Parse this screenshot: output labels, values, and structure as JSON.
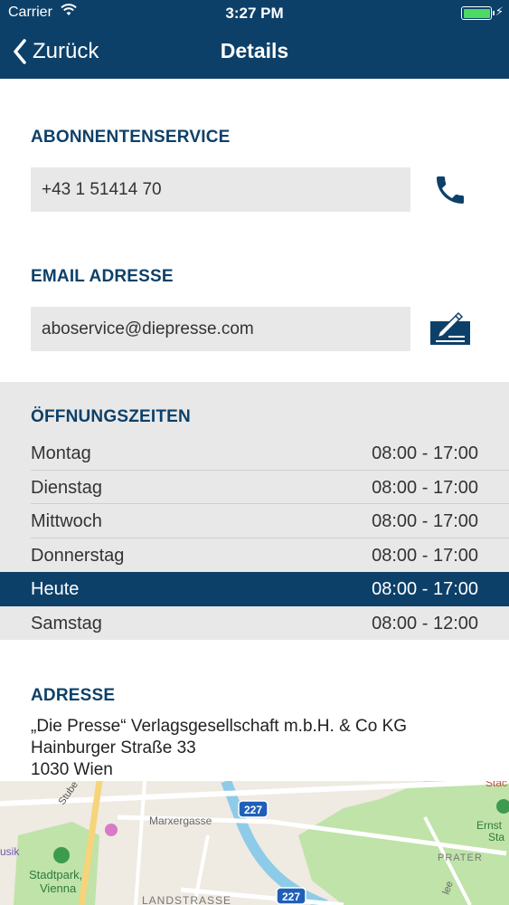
{
  "status_bar": {
    "carrier": "Carrier",
    "time": "3:27 PM"
  },
  "nav": {
    "back_label": "Zurück",
    "title": "Details"
  },
  "subscriber_service": {
    "title": "ABONNENTENSERVICE",
    "phone": "+43 1 51414 70"
  },
  "email": {
    "title": "EMAIL ADRESSE",
    "address": "aboservice@diepresse.com"
  },
  "opening_hours": {
    "title": "ÖFFNUNGSZEITEN",
    "rows": [
      {
        "day": "Montag",
        "time": "08:00 - 17:00"
      },
      {
        "day": "Dienstag",
        "time": "08:00 - 17:00"
      },
      {
        "day": "Mittwoch",
        "time": "08:00 - 17:00"
      },
      {
        "day": "Donnerstag",
        "time": "08:00 - 17:00"
      },
      {
        "day": "Heute",
        "time": "08:00 - 17:00"
      },
      {
        "day": "Samstag",
        "time": "08:00 - 12:00"
      }
    ]
  },
  "address": {
    "title": "ADRESSE",
    "lines": [
      "„Die Presse“ Verlagsgesellschaft m.b.H. & Co KG",
      "Hainburger Straße 33",
      "1030 Wien"
    ]
  },
  "map": {
    "labels": {
      "stube": "Stube",
      "marxergasse": "Marxergasse",
      "usik": "usik",
      "stadtpark": "Stadtpark,",
      "vienna": "Vienna",
      "landstrasse": "LANDSTRASSE",
      "prater": "PRATER",
      "ernst": "Ernst",
      "sta": "Sta",
      "stac": "Stac",
      "ee": "lee",
      "route_227_a": "227",
      "route_227_b": "227"
    }
  },
  "colors": {
    "navy": "#0d4069",
    "field_bg": "#e8e8e8",
    "battery_green": "#4cd964"
  }
}
